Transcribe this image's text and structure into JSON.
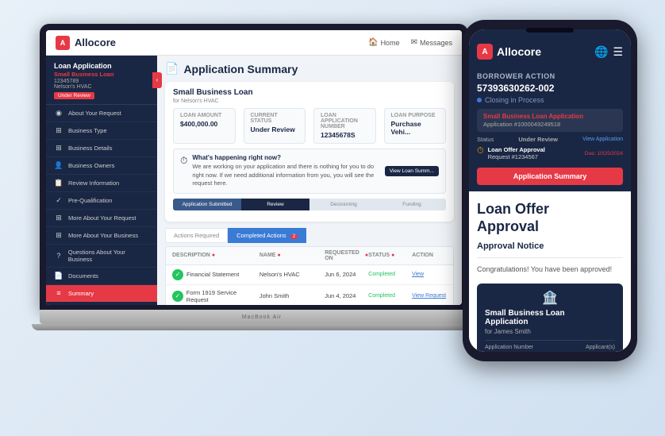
{
  "app": {
    "logo_text": "Allocore",
    "logo_char": "A",
    "nav": {
      "home": "Home",
      "messages": "Messages"
    }
  },
  "sidebar": {
    "section_title": "Loan Application",
    "loan_type": "Small Business Loan",
    "loan_id": "12345789",
    "business_name": "Nelson's HVAC",
    "status": "Under Review",
    "toggle_char": "‹",
    "items": [
      {
        "label": "About Your Request",
        "icon": "◉",
        "active": false
      },
      {
        "label": "Business Type",
        "icon": "⊞",
        "active": false
      },
      {
        "label": "Business Details",
        "icon": "⊞",
        "active": false
      },
      {
        "label": "Business Owners",
        "icon": "👤",
        "active": false
      },
      {
        "label": "Review Information",
        "icon": "📋",
        "active": false
      },
      {
        "label": "Pre-Qualification",
        "icon": "✓",
        "active": false
      },
      {
        "label": "More About Your Request",
        "icon": "⊞",
        "active": false
      },
      {
        "label": "More About Your Business",
        "icon": "⊞",
        "active": false
      },
      {
        "label": "Questions About Your Business",
        "icon": "?",
        "active": false
      },
      {
        "label": "Documents",
        "icon": "📄",
        "active": false
      },
      {
        "label": "Summary",
        "icon": "≡",
        "active": true
      }
    ]
  },
  "main": {
    "page_title": "Application Summary",
    "page_icon": "📄",
    "loan_name": "Small Business Loan",
    "loan_for": "for Nelson's HVAC",
    "fields": {
      "loan_amount_label": "Loan Amount",
      "loan_amount_value": "$400,000.00",
      "status_label": "Current Status",
      "status_value": "Under Review",
      "app_number_label": "Loan Application Number",
      "app_number_value": "12345678S",
      "purpose_label": "Loan Purpose",
      "purpose_value": "Purchase Vehi..."
    },
    "happening": {
      "title": "What's happening right now?",
      "text": "We are working on your application and there is nothing for you to do right now. If we need additional information from you, you will see the request here.",
      "btn_label": "View Loan Summ..."
    },
    "progress": [
      {
        "label": "Application Submitted",
        "state": "done"
      },
      {
        "label": "Review",
        "state": "active"
      },
      {
        "label": "Decisioning",
        "state": "default"
      },
      {
        "label": "Funding",
        "state": "default"
      }
    ],
    "tabs": [
      {
        "label": "Actions Required",
        "active": false,
        "badge": null
      },
      {
        "label": "Completed Actions",
        "active": true,
        "badge": "2"
      }
    ],
    "table": {
      "headers": [
        "Description",
        "Name",
        "Requested On",
        "Status",
        "Action"
      ],
      "rows": [
        {
          "description": "Financial Statement",
          "name": "Nelson's HVAC",
          "requested_on": "Jun 6, 2024",
          "status": "Completed",
          "action": "View"
        },
        {
          "description": "Form 1919 Service Request",
          "name": "John Smith",
          "requested_on": "Jun 4, 2024",
          "status": "Completed",
          "action": "View Request"
        }
      ]
    }
  },
  "phone": {
    "logo_text": "Allocore",
    "logo_char": "A",
    "borrower_action": {
      "panel_title": "Borrower Action",
      "app_number": "57393630262-002",
      "closing_label": "Closing in Process",
      "app_info_title": "Small Business Loan Application",
      "app_info_number": "Application #1000049249518",
      "status_label": "Status",
      "status_value": "Under Review",
      "view_app_btn": "View Application",
      "offer_title": "Loan Offer Approval",
      "offer_request": "Request #1234567",
      "offer_due": "Due: 10/25/2024",
      "summary_btn": "Application Summary"
    },
    "loan_offer": {
      "title": "Loan Offer\nApproval",
      "subtitle": "Approval Notice",
      "text": "Congratulations! You have been approved!",
      "card_icon": "🏦",
      "card_title": "Small Business Loan\nApplication",
      "card_subtitle": "for James Smith",
      "footer_app_label": "Application Number",
      "footer_app_value": "",
      "footer_applicant_label": "Applicant(s)",
      "footer_applicant_value": ""
    }
  },
  "colors": {
    "brand_dark": "#1a2744",
    "brand_red": "#e63946",
    "brand_blue": "#3a7bd5",
    "success": "#22c55e"
  }
}
